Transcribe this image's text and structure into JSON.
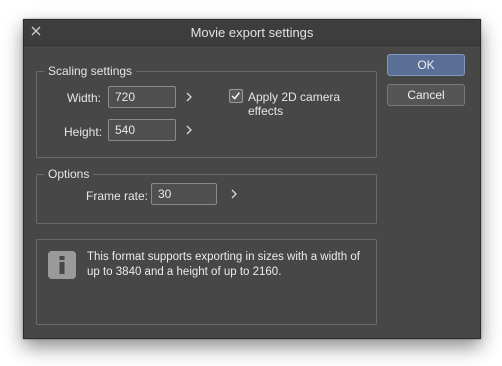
{
  "window": {
    "title": "Movie export settings"
  },
  "buttons": {
    "ok_label": "OK",
    "cancel_label": "Cancel"
  },
  "scaling": {
    "group_label": "Scaling settings",
    "width_label": "Width:",
    "width_value": "720",
    "height_label": "Height:",
    "height_value": "540",
    "camera_effects_label": "Apply 2D camera effects",
    "camera_effects_checked": true
  },
  "options": {
    "group_label": "Options",
    "frame_rate_label": "Frame rate:",
    "frame_rate_value": "30"
  },
  "info": {
    "message": "This format supports exporting in sizes with a width of up to 3840 and a height of up to 2160."
  },
  "colors": {
    "dialog_bg": "#474747",
    "ok_button": "#5a6f96"
  },
  "icons": [
    "close-icon",
    "chevron-right-icon",
    "checkmark-icon",
    "info-icon"
  ]
}
